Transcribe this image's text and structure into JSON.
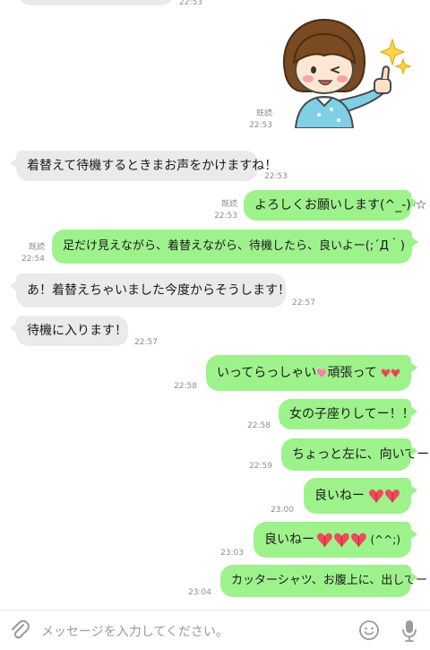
{
  "messages": {
    "top_time": "22:53",
    "sticker_read": "既読",
    "sticker_time": "22:53",
    "m1": {
      "text": "着替えて待機するときまお声をかけますね！",
      "time": "22:53"
    },
    "m2": {
      "text": "よろしくお願いします(^_-)-☆",
      "read": "既読",
      "time": "22:53"
    },
    "m3": {
      "text_a": "足だけ見えながら、着替えながら、待機したら、良いよー(;´Д｀)",
      "read": "既読",
      "time": "22:54"
    },
    "m4": {
      "text_a": "あ！着替えちゃいました",
      "text_b": "今度からそうします！",
      "time": "22:57"
    },
    "m5": {
      "text": "待機に入ります！",
      "time": "22:57"
    },
    "m6": {
      "text_a": "いってらっしゃい",
      "text_b": "頑張って",
      "time": "22:58"
    },
    "m7": {
      "text": "女の子座りしてー！！",
      "time": "22:58"
    },
    "m8": {
      "text": "ちょっと左に、向いてー",
      "time": "22:59"
    },
    "m9": {
      "text": "良いねー",
      "time": "23:00"
    },
    "m10": {
      "text_a": "良いねー",
      "text_b": "(^^;)",
      "time": "23:03"
    },
    "m11": {
      "text": "カッターシャツ、お腹上に、出してー",
      "time": "23:04"
    }
  },
  "composer": {
    "placeholder": "メッセージを入力してください。",
    "icons": [
      "paperclip-icon",
      "emoji-icon",
      "microphone-icon"
    ]
  },
  "colors": {
    "outgoing_bubble": "#9ef28c",
    "incoming_bubble": "#eaeaec",
    "meta_text": "#8c8c8c",
    "heart": "#ee4b5a"
  }
}
